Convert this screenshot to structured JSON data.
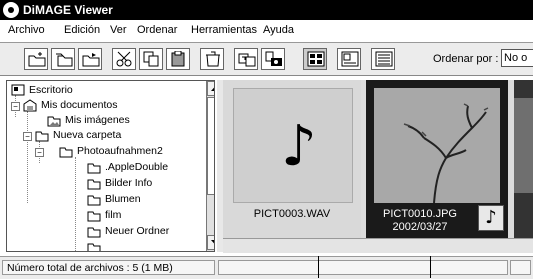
{
  "window": {
    "title": "DiMAGE Viewer"
  },
  "menu": [
    "Archivo",
    "Edición",
    "Ver",
    "Ordenar",
    "Herramientas",
    "Ayuda"
  ],
  "toolbar": {
    "buttons": [
      "new-folder",
      "copy-folder",
      "move-folder",
      "cut",
      "copy",
      "paste",
      "delete",
      "import",
      "camera",
      "view-large-thumbnails",
      "view-small-thumbnails",
      "view-details"
    ],
    "sort_label": "Ordenar por :",
    "sort_value": "No o"
  },
  "tree": {
    "items": [
      {
        "label": "Escritorio",
        "icon": "desktop-icon"
      },
      {
        "label": "Mis documentos",
        "icon": "documents-icon"
      },
      {
        "label": "Mis imágenes",
        "icon": "pictures-folder-icon"
      },
      {
        "label": "Nueva carpeta",
        "icon": "folder-icon"
      },
      {
        "label": "Photoaufnahmen2",
        "icon": "folder-icon"
      },
      {
        "label": ".AppleDouble",
        "icon": "folder-icon"
      },
      {
        "label": "Bilder Info",
        "icon": "folder-icon"
      },
      {
        "label": "Blumen",
        "icon": "folder-icon"
      },
      {
        "label": "film",
        "icon": "folder-icon"
      },
      {
        "label": "Neuer Ordner",
        "icon": "folder-icon"
      }
    ]
  },
  "thumbnails": [
    {
      "filename": "PICT0003.WAV",
      "icon": "music-note-icon",
      "selected": false
    },
    {
      "filename": "PICT0010.JPG",
      "date": "2002/03/27",
      "badge_icon": "music-note-icon",
      "selected": true
    }
  ],
  "status": {
    "total_files": "Número total de archivos : 5 (1 MB)"
  },
  "colors": {
    "title_bar": "#000000",
    "selected_card": "#1a1a1a",
    "card": "#d9d9d9"
  }
}
